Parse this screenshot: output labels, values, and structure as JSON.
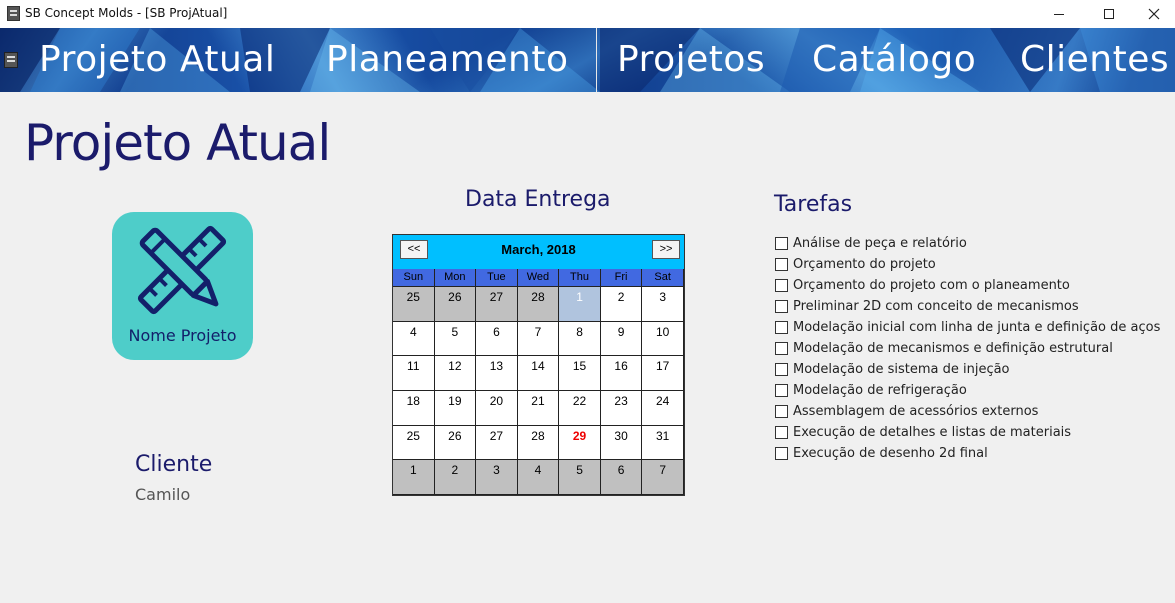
{
  "window": {
    "title": "SB Concept Molds - [SB ProjAtual]",
    "app_icon": "app-icon",
    "controls": [
      "minimize",
      "maximize",
      "close"
    ]
  },
  "nav": {
    "items": [
      {
        "label": "Projeto Atual"
      },
      {
        "label": "Planeamento"
      },
      {
        "label": "Projetos"
      },
      {
        "label": "Catálogo"
      },
      {
        "label": "Clientes"
      }
    ]
  },
  "main": {
    "title": "Projeto Atual",
    "project": {
      "name": "Nome Projeto",
      "icon": "ruler-pencil-icon",
      "color": "#4ecdc9"
    },
    "cliente": {
      "label": "Cliente",
      "value": "Camilo"
    },
    "entrega": {
      "label": "Data Entrega"
    },
    "calendar": {
      "month_label": "March, 2018",
      "prev_label": "<<",
      "next_label": ">>",
      "days_of_week": [
        "Sun",
        "Mon",
        "Tue",
        "Wed",
        "Thu",
        "Fri",
        "Sat"
      ],
      "weeks": [
        [
          {
            "d": "25",
            "type": "other"
          },
          {
            "d": "26",
            "type": "other"
          },
          {
            "d": "27",
            "type": "other"
          },
          {
            "d": "28",
            "type": "other"
          },
          {
            "d": "1",
            "type": "selected"
          },
          {
            "d": "2",
            "type": "current"
          },
          {
            "d": "3",
            "type": "current"
          }
        ],
        [
          {
            "d": "4",
            "type": "current"
          },
          {
            "d": "5",
            "type": "current"
          },
          {
            "d": "6",
            "type": "current"
          },
          {
            "d": "7",
            "type": "current"
          },
          {
            "d": "8",
            "type": "current"
          },
          {
            "d": "9",
            "type": "current"
          },
          {
            "d": "10",
            "type": "current"
          }
        ],
        [
          {
            "d": "11",
            "type": "current"
          },
          {
            "d": "12",
            "type": "current"
          },
          {
            "d": "13",
            "type": "current"
          },
          {
            "d": "14",
            "type": "current"
          },
          {
            "d": "15",
            "type": "current"
          },
          {
            "d": "16",
            "type": "current"
          },
          {
            "d": "17",
            "type": "current"
          }
        ],
        [
          {
            "d": "18",
            "type": "current"
          },
          {
            "d": "19",
            "type": "current"
          },
          {
            "d": "20",
            "type": "current"
          },
          {
            "d": "21",
            "type": "current"
          },
          {
            "d": "22",
            "type": "current"
          },
          {
            "d": "23",
            "type": "current"
          },
          {
            "d": "24",
            "type": "current"
          }
        ],
        [
          {
            "d": "25",
            "type": "current"
          },
          {
            "d": "26",
            "type": "current"
          },
          {
            "d": "27",
            "type": "current"
          },
          {
            "d": "28",
            "type": "current"
          },
          {
            "d": "29",
            "type": "today"
          },
          {
            "d": "30",
            "type": "current"
          },
          {
            "d": "31",
            "type": "current"
          }
        ],
        [
          {
            "d": "1",
            "type": "other"
          },
          {
            "d": "2",
            "type": "other"
          },
          {
            "d": "3",
            "type": "other"
          },
          {
            "d": "4",
            "type": "other"
          },
          {
            "d": "5",
            "type": "other"
          },
          {
            "d": "6",
            "type": "other"
          },
          {
            "d": "7",
            "type": "other"
          }
        ]
      ],
      "colors": {
        "header": "#00bfff",
        "dow": "#4169e1",
        "other_month": "#c0c0c0",
        "selected": "#b0c4de",
        "today_text": "#ee0000"
      }
    },
    "tarefas": {
      "label": "Tarefas",
      "items": [
        {
          "label": "Análise de peça e relatório",
          "checked": false
        },
        {
          "label": "Orçamento do projeto",
          "checked": false
        },
        {
          "label": "Orçamento do projeto com o planeamento",
          "checked": false
        },
        {
          "label": "Preliminar 2D com conceito de mecanismos",
          "checked": false
        },
        {
          "label": "Modelação inicial com linha de junta e definição de aços",
          "checked": false
        },
        {
          "label": "Modelação de mecanismos e definição estrutural",
          "checked": false
        },
        {
          "label": "Modelação de sistema de injeção",
          "checked": false
        },
        {
          "label": "Modelação de refrigeração",
          "checked": false
        },
        {
          "label": "Assemblagem de acessórios externos",
          "checked": false
        },
        {
          "label": "Execução de detalhes e listas de materiais",
          "checked": false
        },
        {
          "label": "Execução de desenho 2d final",
          "checked": false
        }
      ]
    }
  },
  "colors": {
    "heading": "#1b1b6b",
    "background": "#f0f0f0",
    "nav_text": "#ffffff"
  }
}
